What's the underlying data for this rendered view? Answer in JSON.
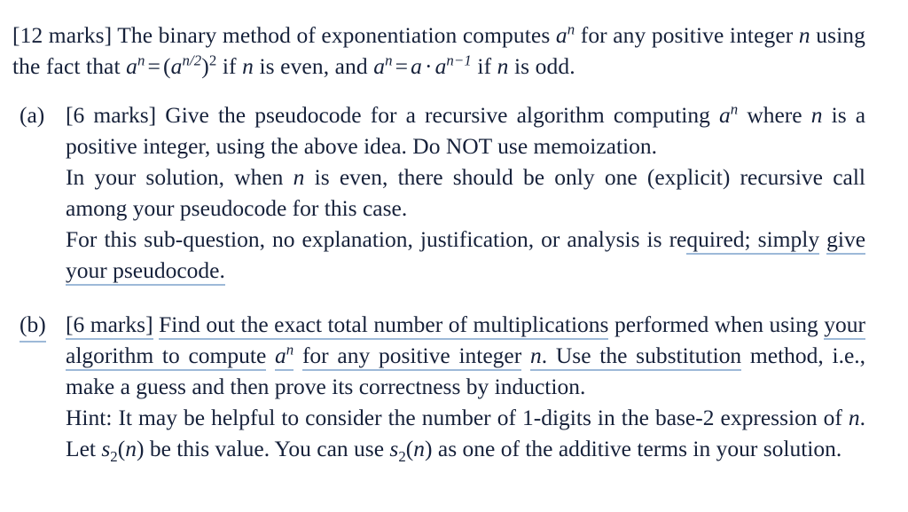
{
  "document": {
    "type": "exam-question",
    "background_color": "#ffffff",
    "text_color": "#16213a",
    "underline_color": "#9db9d8"
  },
  "stem": {
    "marks": "[12 marks]",
    "text_1": "The binary method of exponentiation computes",
    "math_an_1": "a",
    "math_an_1_exp": "n",
    "text_2": "for any positive integer",
    "math_n_1": "n",
    "text_3": "using the fact that",
    "eq1_lhs_base": "a",
    "eq1_lhs_exp": "n",
    "eq1_equals": "=",
    "eq1_open": "(",
    "eq1_inner_base": "a",
    "eq1_inner_exp": "n/2",
    "eq1_close": ")",
    "eq1_outer_exp": "2",
    "text_4": "if",
    "math_n_2": "n",
    "text_5": "is even, and",
    "eq2_lhs_base": "a",
    "eq2_lhs_exp": "n",
    "eq2_equals": "=",
    "eq2_a": "a",
    "eq2_dot": "·",
    "eq2_rhs_base": "a",
    "eq2_rhs_exp": "n−1",
    "text_6": "if",
    "math_n_3": "n",
    "text_7": "is odd."
  },
  "items": [
    {
      "label": "(a)",
      "marks": "[6 marks]",
      "blocks": [
        {
          "id": "a-b1",
          "text_1": "Give the pseudocode for a recursive algorithm computing",
          "math_base": "a",
          "math_exp": "n",
          "text_2": "where",
          "math_n": "n",
          "text_3": "is a positive integer, using the above idea. Do NOT use memoization."
        },
        {
          "id": "a-b2",
          "text_1": "In your solution, when",
          "math_n": "n",
          "text_2": "is even, there should be only one (explicit) recursive call among your pseudocode for this case."
        },
        {
          "id": "a-b3",
          "text_1": "For this sub-question, no explanation, justification, or analysis is re",
          "underlined_1": "quired; simply",
          "underlined_2": "give your pseudocode."
        }
      ]
    },
    {
      "label": "(b)",
      "marks": "[6 marks]",
      "blocks": [
        {
          "id": "b-b1",
          "underlined_marks": "[6 marks]",
          "underlined_1": "Find out the exact total number of multiplications",
          "text_1": "performed when using",
          "underlined_2": "your algorithm to compute",
          "math_base": "a",
          "math_exp": "n",
          "underlined_3": "for any positive integer",
          "math_n": "n",
          "underlined_4": ".  Use the substitution",
          "text_2": "method, i.e., make a guess and then prove its correctness by induction."
        },
        {
          "id": "b-b2",
          "text_1": "Hint: It may be helpful to consider the number of 1-digits in the base-2 expression of",
          "math_n_1": "n",
          "text_2": ". Let",
          "math_s2_name": "s",
          "math_s2_sub": "2",
          "math_s2_open": "(",
          "math_s2_arg": "n",
          "math_s2_close": ")",
          "text_3": "be this value. You can use",
          "math_s2b_name": "s",
          "math_s2b_sub": "2",
          "math_s2b_open": "(",
          "math_s2b_arg": "n",
          "math_s2b_close": ")",
          "text_4": "as one of the additive terms in your solution."
        }
      ]
    }
  ]
}
